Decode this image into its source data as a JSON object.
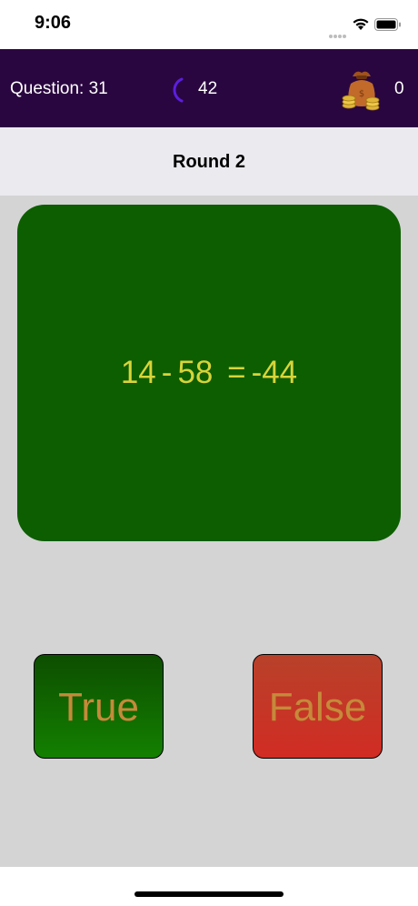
{
  "status_bar": {
    "time": "9:06"
  },
  "top_bar": {
    "question_text": "Question: 31",
    "timer_value": "42",
    "coins_value": "0",
    "background_color": "#2a0640"
  },
  "round": {
    "title": "Round 2"
  },
  "question": {
    "operand_a": "14",
    "operator": "-",
    "operand_b": "58",
    "equals": "=",
    "result": "-44",
    "card_color": "#0c5e00",
    "text_color": "#d8d43a"
  },
  "buttons": {
    "true_label": "True",
    "false_label": "False"
  },
  "icons": {
    "timer": "timer-arc-icon",
    "coins": "money-bag-icon",
    "wifi": "wifi-icon",
    "battery": "battery-icon"
  }
}
